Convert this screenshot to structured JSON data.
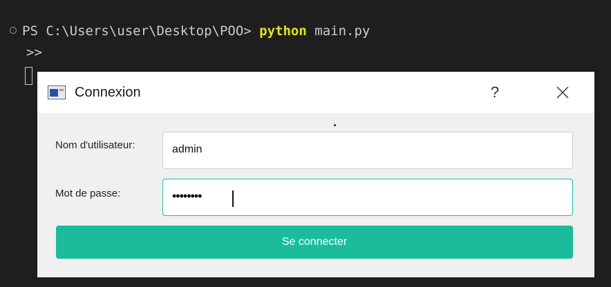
{
  "terminal": {
    "prompt": "PS C:\\Users\\user\\Desktop\\POO> ",
    "command": "python",
    "args": " main.py",
    "continuation": ">>"
  },
  "dialog": {
    "title": "Connexion",
    "help_label": "?",
    "username_label": "Nom d'utilisateur:",
    "username_value": "admin",
    "password_label": "Mot de passe:",
    "password_value": "••••••••",
    "connect_label": "Se connecter",
    "icons": {
      "window": "app-window-icon",
      "close": "close-icon"
    },
    "colors": {
      "accent": "#1abc9c"
    }
  }
}
